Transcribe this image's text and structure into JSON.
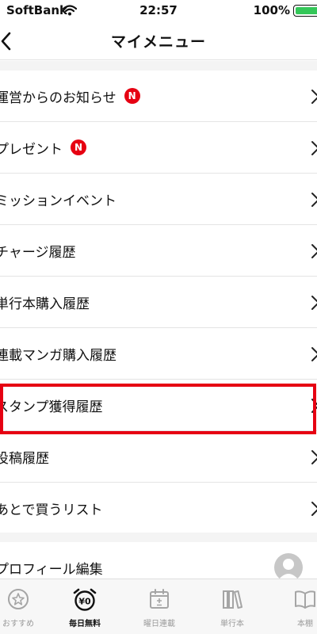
{
  "status_bar": {
    "carrier": "SoftBank",
    "time": "22:57",
    "battery": "100%",
    "battery_color": "#34c759"
  },
  "nav": {
    "title": "マイメニュー",
    "back_icon": "chevron-left-icon"
  },
  "menu_items": [
    {
      "label": "運営からのお知らせ",
      "badge": "N"
    },
    {
      "label": "プレゼント",
      "badge": "N"
    },
    {
      "label": "ミッションイベント"
    },
    {
      "label": "チャージ履歴"
    },
    {
      "label": "単行本購入履歴"
    },
    {
      "label": "連載マンガ購入履歴"
    },
    {
      "label": "スタンプ獲得履歴",
      "highlighted": true
    },
    {
      "label": "投稿履歴"
    },
    {
      "label": "あとで買うリスト"
    }
  ],
  "profile": {
    "label": "プロフィール編集"
  },
  "tabs": [
    {
      "label": "おすすめ",
      "icon": "star-badge-icon"
    },
    {
      "label": "毎日無料",
      "icon": "alarm-clock-yen-icon",
      "active": true
    },
    {
      "label": "曜日連載",
      "icon": "calendar-icon"
    },
    {
      "label": "単行本",
      "icon": "books-icon"
    },
    {
      "label": "本棚",
      "icon": "open-book-icon"
    }
  ],
  "colors": {
    "accent_red": "#e60012",
    "separator": "#e4e4e4"
  }
}
